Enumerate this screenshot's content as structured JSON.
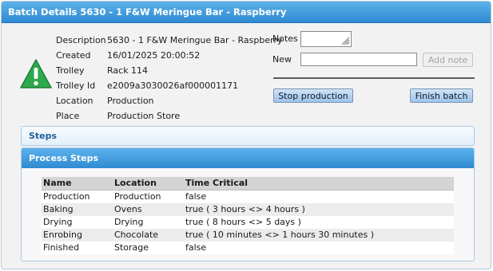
{
  "window": {
    "title": "Batch Details 5630 - 1 F&W Meringue Bar - Raspberry"
  },
  "details": [
    {
      "label": "Description",
      "value": "5630 - 1 F&W Meringue Bar - Raspberry"
    },
    {
      "label": "Created",
      "value": "16/01/2025 20:00:52"
    },
    {
      "label": "Trolley",
      "value": "Rack 114"
    },
    {
      "label": "Trolley Id",
      "value": "e2009a3030026af000001171"
    },
    {
      "label": "Location",
      "value": "Production"
    },
    {
      "label": "Place",
      "value": "Production Store"
    }
  ],
  "notes": {
    "label": "Notes",
    "value": ""
  },
  "new_note": {
    "label": "New",
    "value": "",
    "add_label": "Add note"
  },
  "actions": {
    "stop_label": "Stop production",
    "finish_label": "Finish batch"
  },
  "steps_panel": {
    "title": "Steps"
  },
  "process_panel": {
    "title": "Process Steps",
    "columns": [
      "Name",
      "Location",
      "Time Critical"
    ],
    "rows": [
      [
        "Production",
        "Production",
        "false"
      ],
      [
        "Baking",
        "Ovens",
        "true ( 3 hours <> 4 hours )"
      ],
      [
        "Drying",
        "Drying",
        "true ( 8 hours <> 5 days )"
      ],
      [
        "Enrobing",
        "Chocolate",
        "true ( 10 minutes <> 1 hours 30 minutes )"
      ],
      [
        "Finished",
        "Storage",
        "false"
      ]
    ]
  },
  "icons": {
    "status": "warning-icon"
  },
  "colors": {
    "accent": "#2f8ad2",
    "warning": "#2ea84c",
    "button": "#9fc3ea"
  }
}
